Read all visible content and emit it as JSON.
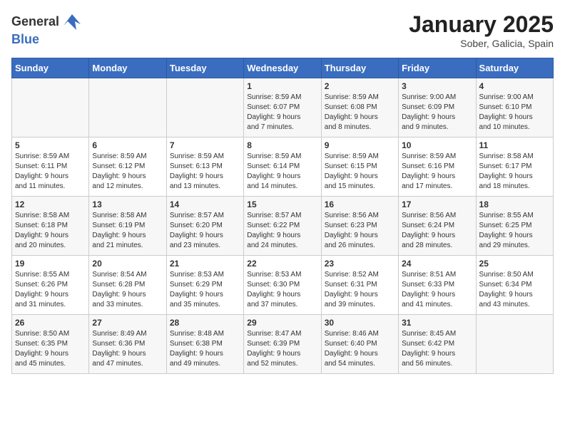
{
  "header": {
    "logo_general": "General",
    "logo_blue": "Blue",
    "title": "January 2025",
    "subtitle": "Sober, Galicia, Spain"
  },
  "days_of_week": [
    "Sunday",
    "Monday",
    "Tuesday",
    "Wednesday",
    "Thursday",
    "Friday",
    "Saturday"
  ],
  "weeks": [
    [
      {
        "day": "",
        "info": ""
      },
      {
        "day": "",
        "info": ""
      },
      {
        "day": "",
        "info": ""
      },
      {
        "day": "1",
        "info": "Sunrise: 8:59 AM\nSunset: 6:07 PM\nDaylight: 9 hours\nand 7 minutes."
      },
      {
        "day": "2",
        "info": "Sunrise: 8:59 AM\nSunset: 6:08 PM\nDaylight: 9 hours\nand 8 minutes."
      },
      {
        "day": "3",
        "info": "Sunrise: 9:00 AM\nSunset: 6:09 PM\nDaylight: 9 hours\nand 9 minutes."
      },
      {
        "day": "4",
        "info": "Sunrise: 9:00 AM\nSunset: 6:10 PM\nDaylight: 9 hours\nand 10 minutes."
      }
    ],
    [
      {
        "day": "5",
        "info": "Sunrise: 8:59 AM\nSunset: 6:11 PM\nDaylight: 9 hours\nand 11 minutes."
      },
      {
        "day": "6",
        "info": "Sunrise: 8:59 AM\nSunset: 6:12 PM\nDaylight: 9 hours\nand 12 minutes."
      },
      {
        "day": "7",
        "info": "Sunrise: 8:59 AM\nSunset: 6:13 PM\nDaylight: 9 hours\nand 13 minutes."
      },
      {
        "day": "8",
        "info": "Sunrise: 8:59 AM\nSunset: 6:14 PM\nDaylight: 9 hours\nand 14 minutes."
      },
      {
        "day": "9",
        "info": "Sunrise: 8:59 AM\nSunset: 6:15 PM\nDaylight: 9 hours\nand 15 minutes."
      },
      {
        "day": "10",
        "info": "Sunrise: 8:59 AM\nSunset: 6:16 PM\nDaylight: 9 hours\nand 17 minutes."
      },
      {
        "day": "11",
        "info": "Sunrise: 8:58 AM\nSunset: 6:17 PM\nDaylight: 9 hours\nand 18 minutes."
      }
    ],
    [
      {
        "day": "12",
        "info": "Sunrise: 8:58 AM\nSunset: 6:18 PM\nDaylight: 9 hours\nand 20 minutes."
      },
      {
        "day": "13",
        "info": "Sunrise: 8:58 AM\nSunset: 6:19 PM\nDaylight: 9 hours\nand 21 minutes."
      },
      {
        "day": "14",
        "info": "Sunrise: 8:57 AM\nSunset: 6:20 PM\nDaylight: 9 hours\nand 23 minutes."
      },
      {
        "day": "15",
        "info": "Sunrise: 8:57 AM\nSunset: 6:22 PM\nDaylight: 9 hours\nand 24 minutes."
      },
      {
        "day": "16",
        "info": "Sunrise: 8:56 AM\nSunset: 6:23 PM\nDaylight: 9 hours\nand 26 minutes."
      },
      {
        "day": "17",
        "info": "Sunrise: 8:56 AM\nSunset: 6:24 PM\nDaylight: 9 hours\nand 28 minutes."
      },
      {
        "day": "18",
        "info": "Sunrise: 8:55 AM\nSunset: 6:25 PM\nDaylight: 9 hours\nand 29 minutes."
      }
    ],
    [
      {
        "day": "19",
        "info": "Sunrise: 8:55 AM\nSunset: 6:26 PM\nDaylight: 9 hours\nand 31 minutes."
      },
      {
        "day": "20",
        "info": "Sunrise: 8:54 AM\nSunset: 6:28 PM\nDaylight: 9 hours\nand 33 minutes."
      },
      {
        "day": "21",
        "info": "Sunrise: 8:53 AM\nSunset: 6:29 PM\nDaylight: 9 hours\nand 35 minutes."
      },
      {
        "day": "22",
        "info": "Sunrise: 8:53 AM\nSunset: 6:30 PM\nDaylight: 9 hours\nand 37 minutes."
      },
      {
        "day": "23",
        "info": "Sunrise: 8:52 AM\nSunset: 6:31 PM\nDaylight: 9 hours\nand 39 minutes."
      },
      {
        "day": "24",
        "info": "Sunrise: 8:51 AM\nSunset: 6:33 PM\nDaylight: 9 hours\nand 41 minutes."
      },
      {
        "day": "25",
        "info": "Sunrise: 8:50 AM\nSunset: 6:34 PM\nDaylight: 9 hours\nand 43 minutes."
      }
    ],
    [
      {
        "day": "26",
        "info": "Sunrise: 8:50 AM\nSunset: 6:35 PM\nDaylight: 9 hours\nand 45 minutes."
      },
      {
        "day": "27",
        "info": "Sunrise: 8:49 AM\nSunset: 6:36 PM\nDaylight: 9 hours\nand 47 minutes."
      },
      {
        "day": "28",
        "info": "Sunrise: 8:48 AM\nSunset: 6:38 PM\nDaylight: 9 hours\nand 49 minutes."
      },
      {
        "day": "29",
        "info": "Sunrise: 8:47 AM\nSunset: 6:39 PM\nDaylight: 9 hours\nand 52 minutes."
      },
      {
        "day": "30",
        "info": "Sunrise: 8:46 AM\nSunset: 6:40 PM\nDaylight: 9 hours\nand 54 minutes."
      },
      {
        "day": "31",
        "info": "Sunrise: 8:45 AM\nSunset: 6:42 PM\nDaylight: 9 hours\nand 56 minutes."
      },
      {
        "day": "",
        "info": ""
      }
    ]
  ]
}
